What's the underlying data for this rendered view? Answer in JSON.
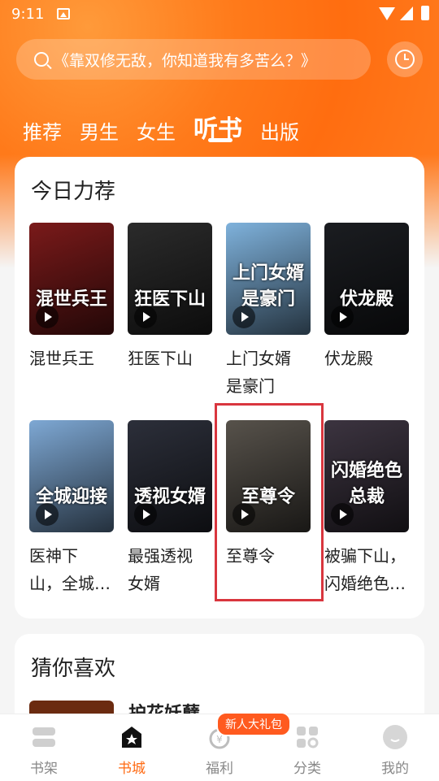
{
  "status": {
    "time": "9:11"
  },
  "search": {
    "placeholder": "《靠双修无敌，你知道我有多苦么？》"
  },
  "tabs": [
    "推荐",
    "男生",
    "女生",
    "听书",
    "出版"
  ],
  "active_tab": "听书",
  "recommend": {
    "title": "今日力荐",
    "books": [
      {
        "title": "混世兵王",
        "cover_text": "混世兵王",
        "cover_color": "#7a1a1a"
      },
      {
        "title": "狂医下山",
        "cover_text": "狂医下山",
        "cover_color": "#2b2b2b"
      },
      {
        "title": "上门女婿\n是豪门",
        "cover_text": "上门女婿是豪门",
        "cover_color": "#7fb2dc"
      },
      {
        "title": "伏龙殿",
        "cover_text": "伏龙殿",
        "cover_color": "#1b1d21"
      },
      {
        "title": "医神下\n山，全城…",
        "cover_text": "全城迎接",
        "cover_color": "#7ea8d4"
      },
      {
        "title": "最强透视\n女婿",
        "cover_text": "透视女婿",
        "cover_color": "#2c2f3a"
      },
      {
        "title": "至尊令",
        "cover_text": "至尊令",
        "cover_color": "#57524b"
      },
      {
        "title": "被骗下山，\n闪婚绝色…",
        "cover_text": "闪婚绝色总裁",
        "cover_color": "#3c3440"
      }
    ]
  },
  "guess": {
    "title": "猜你喜欢",
    "partial_book": "护花妖孽"
  },
  "nav": [
    {
      "label": "书架"
    },
    {
      "label": "书城"
    },
    {
      "label": "福利"
    },
    {
      "label": "分类"
    },
    {
      "label": "我的"
    }
  ],
  "active_nav": "书城",
  "promo_badge": "新人大礼包",
  "colors": {
    "accent": "#ff6a12",
    "highlight": "#d9363e"
  }
}
